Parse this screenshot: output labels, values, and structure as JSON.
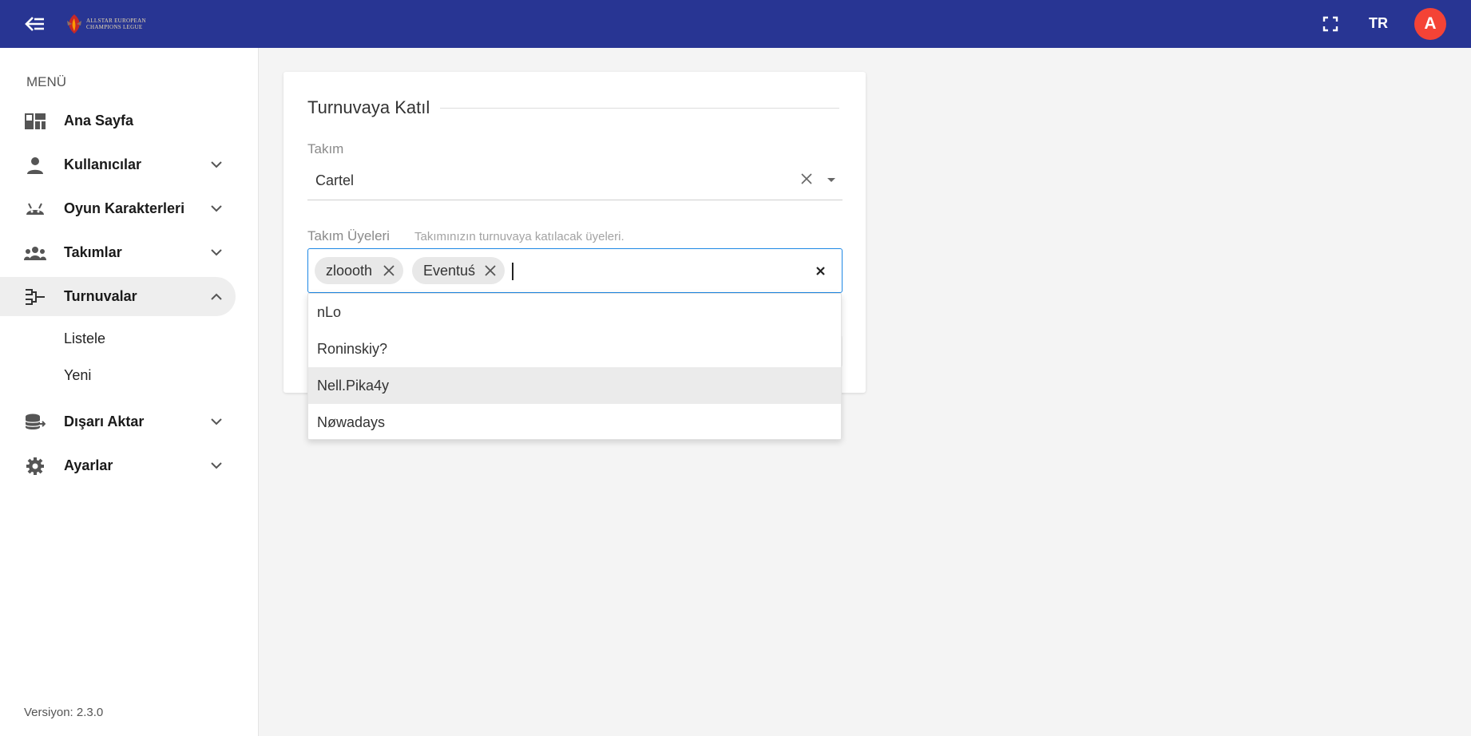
{
  "header": {
    "logo_lines": [
      "ALLSTAR EUROPEAN",
      "CHAMPIONS LEGUE"
    ],
    "language": "TR",
    "avatar_initial": "A",
    "brand_color": "#283593",
    "avatar_color": "#f44336"
  },
  "sidebar": {
    "heading": "MENÜ",
    "items": [
      {
        "label": "Ana Sayfa",
        "icon": "dashboard-icon"
      },
      {
        "label": "Kullanıcılar",
        "icon": "person-icon"
      },
      {
        "label": "Oyun Karakterleri",
        "icon": "android-icon"
      },
      {
        "label": "Takımlar",
        "icon": "group-icon"
      },
      {
        "label": "Turnuvalar",
        "icon": "tournament-bracket-icon"
      },
      {
        "label": "Dışarı Aktar",
        "icon": "database-export-icon"
      },
      {
        "label": "Ayarlar",
        "icon": "gear-icon"
      }
    ],
    "subitems": [
      "Listele",
      "Yeni"
    ],
    "version": "Versiyon: 2.3.0"
  },
  "form": {
    "title": "Turnuvaya Katıl",
    "team_label": "Takım",
    "team_value": "Cartel",
    "members_label": "Takım Üyeleri",
    "members_hint": "Takımınızın turnuvaya katılacak üyeleri.",
    "chips": [
      "zloooth",
      "Eventuś"
    ],
    "options": [
      "nLo",
      "Roninskiy?",
      "Nell.Pika4y",
      "Nøwadays"
    ],
    "focus_color": "#1e88e5"
  }
}
